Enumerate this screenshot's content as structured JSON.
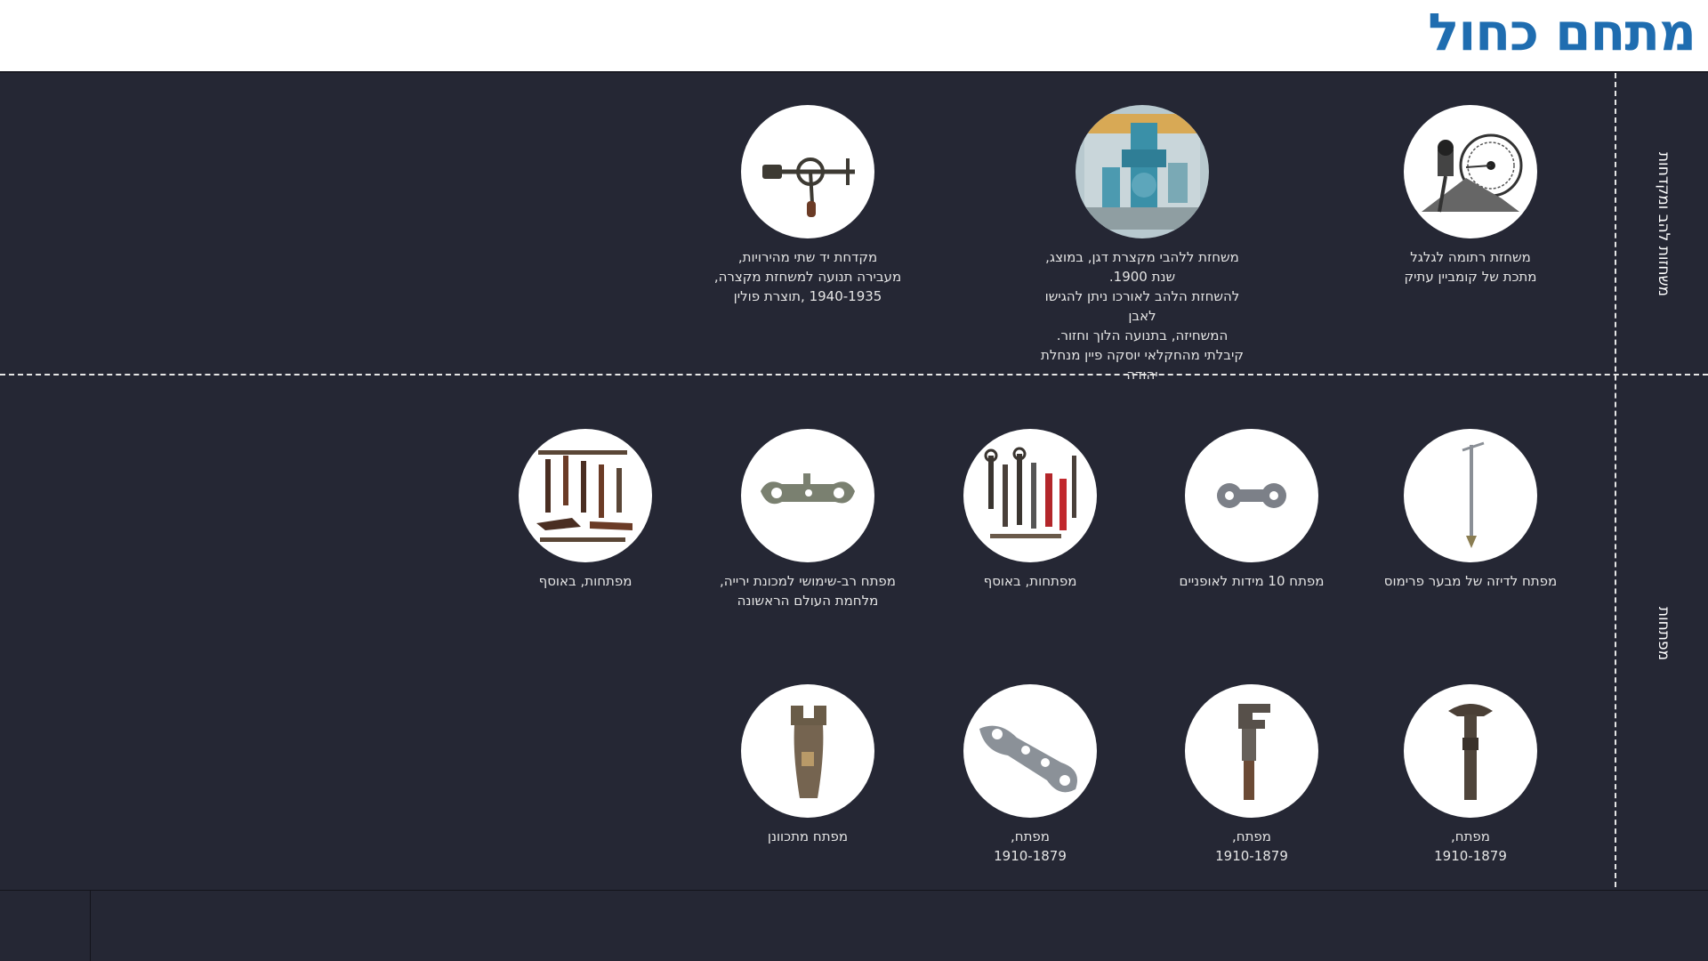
{
  "page": {
    "title": "מתחם כחול"
  },
  "sections": [
    {
      "label": "משחזות להב ומקדחות"
    },
    {
      "label": "מפתחות"
    }
  ],
  "items": [
    {
      "caption": "משחזת רתומה לגלגל\nמתכת של קומביין עתיק",
      "icon": "treadle-sharpener-icon"
    },
    {
      "caption": "משחזת ללהבי מקצרת דגן, במוצג, שנת 1900.\nלהשחזת הלהב לאורכו ניתן להגישו לאבן\nהמשחיזה, בתנועה הלוך וחזור.\nקיבלתי מהחקלאי יוסקה פיין מנחלת יהודה",
      "icon": "blade-grinder-icon"
    },
    {
      "caption": "מקדחת יד שתי מהירויות,\nמעבירה תנועה למשחזת מקצרה,\n1940-1935 ,תוצרת פולין",
      "icon": "hand-drill-icon"
    },
    {
      "caption": "מפתח לדיזה של מבער פרימוס",
      "icon": "primus-key-icon"
    },
    {
      "caption": "מפתח 10 מידות לאופניים",
      "icon": "bicycle-wrench-icon"
    },
    {
      "caption": "מפתחות, באוסף",
      "icon": "wrench-collection-icon"
    },
    {
      "caption": "מפתח רב-שימושי למכונת ירייה,\nמלחמת העולם הראשונה",
      "icon": "multi-wrench-icon"
    },
    {
      "caption": "מפתחות, באוסף",
      "icon": "wrench-collection-2-icon"
    },
    {
      "caption": "מפתח,\n1910-1879",
      "icon": "adjustable-wrench-icon"
    },
    {
      "caption": "מפתח,\n1910-1879",
      "icon": "monkey-wrench-icon"
    },
    {
      "caption": "מפתח,\n1910-1879",
      "icon": "flat-wrench-icon"
    },
    {
      "caption": "מפתח מתכוונן",
      "icon": "adjustable-spanner-icon"
    }
  ]
}
